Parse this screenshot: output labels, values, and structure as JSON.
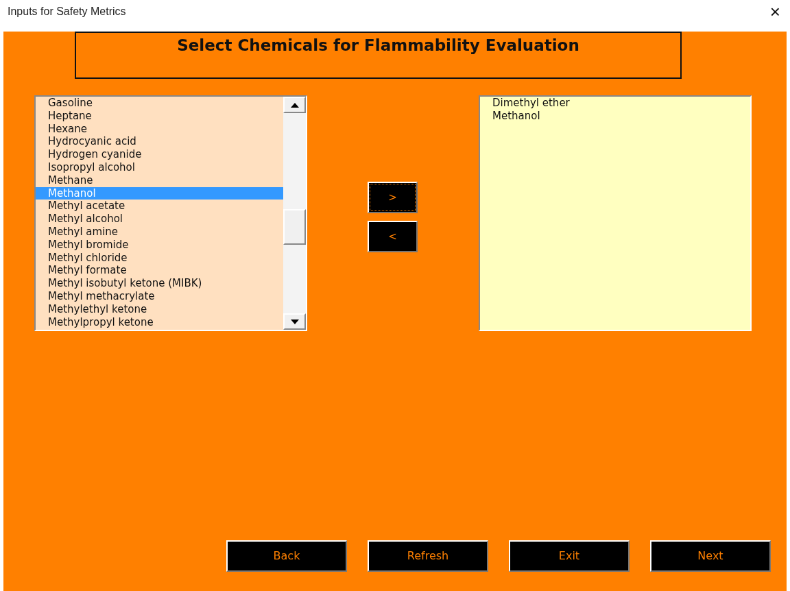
{
  "window": {
    "title": "Inputs for Safety Metrics",
    "close": "×"
  },
  "heading": "Select Chemicals for Flammability Evaluation",
  "available": [
    {
      "label": "Gasoline",
      "selected": false
    },
    {
      "label": "Heptane",
      "selected": false
    },
    {
      "label": "Hexane",
      "selected": false
    },
    {
      "label": "Hydrocyanic acid",
      "selected": false
    },
    {
      "label": "Hydrogen cyanide",
      "selected": false
    },
    {
      "label": "Isopropyl alcohol",
      "selected": false
    },
    {
      "label": "Methane",
      "selected": false
    },
    {
      "label": "Methanol",
      "selected": true
    },
    {
      "label": "Methyl acetate",
      "selected": false
    },
    {
      "label": "Methyl alcohol",
      "selected": false
    },
    {
      "label": "Methyl amine",
      "selected": false
    },
    {
      "label": "Methyl bromide",
      "selected": false
    },
    {
      "label": "Methyl chloride",
      "selected": false
    },
    {
      "label": "Methyl formate",
      "selected": false
    },
    {
      "label": "Methyl isobutyl ketone (MIBK)",
      "selected": false
    },
    {
      "label": "Methyl methacrylate",
      "selected": false
    },
    {
      "label": "Methylethyl ketone",
      "selected": false
    },
    {
      "label": "Methylpropyl ketone",
      "selected": false
    }
  ],
  "move_buttons": [
    {
      "label": ">",
      "focused": true
    },
    {
      "label": "<",
      "focused": false
    }
  ],
  "chosen": [
    {
      "label": "Dimethyl ether",
      "selected": false
    },
    {
      "label": "Methanol",
      "selected": false
    }
  ],
  "buttons": [
    "Back",
    "Refresh",
    "Exit",
    "Next"
  ]
}
